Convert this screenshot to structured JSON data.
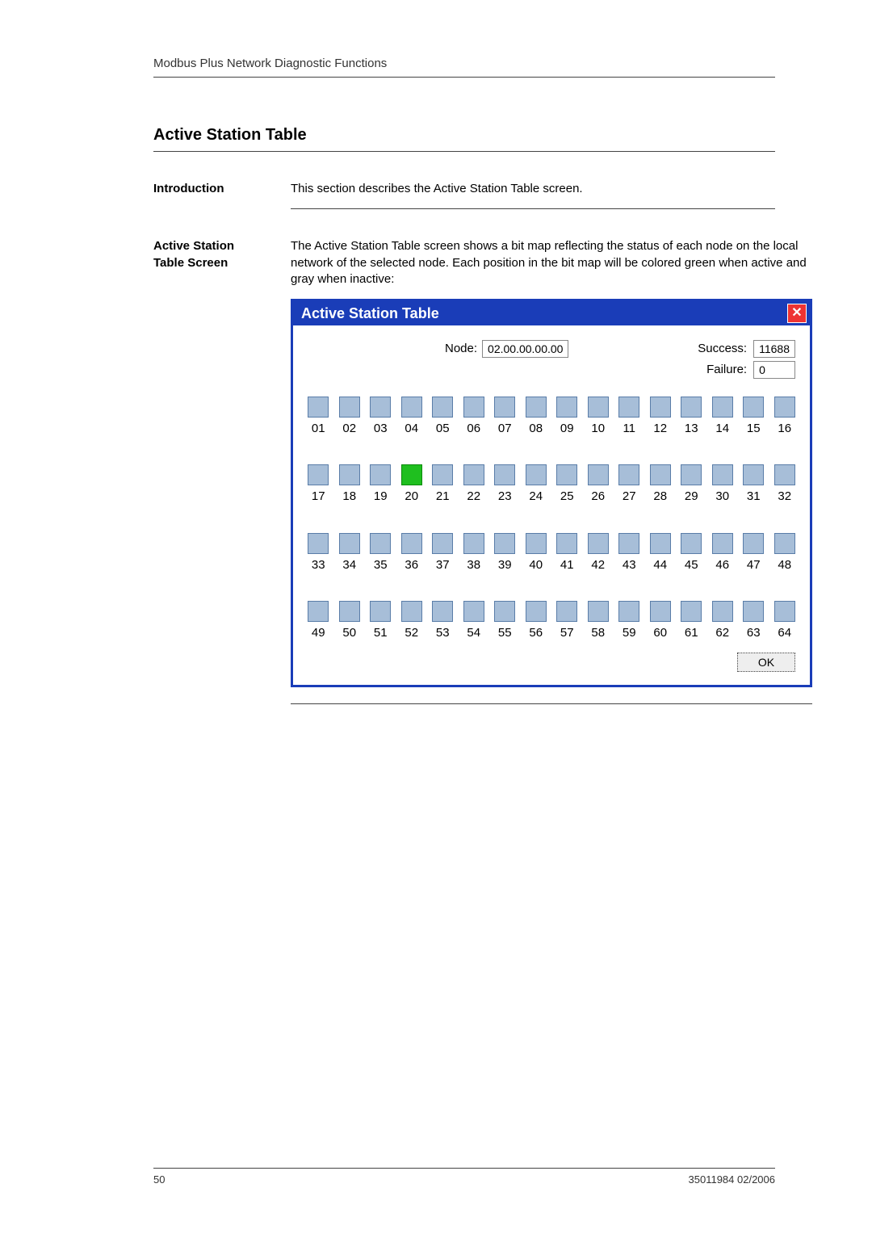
{
  "header": {
    "chapter": "Modbus Plus Network Diagnostic Functions"
  },
  "title": "Active Station Table",
  "intro": {
    "label": "Introduction",
    "text": "This section describes the Active Station Table screen."
  },
  "screen": {
    "label1": "Active Station",
    "label2": "Table Screen",
    "text": "The Active Station Table screen shows a bit map reflecting the status of each node on the local network of the selected node. Each position in the bit map will be colored green when active and gray when inactive:"
  },
  "dialog": {
    "title": "Active Station Table",
    "close": "✕",
    "node_label": "Node:",
    "node_value": "02.00.00.00.00",
    "success_label": "Success:",
    "success_value": "11688",
    "failure_label": "Failure:",
    "failure_value": "0",
    "ok": "OK",
    "active_nodes": [
      20
    ],
    "labels": [
      "01",
      "02",
      "03",
      "04",
      "05",
      "06",
      "07",
      "08",
      "09",
      "10",
      "11",
      "12",
      "13",
      "14",
      "15",
      "16",
      "17",
      "18",
      "19",
      "20",
      "21",
      "22",
      "23",
      "24",
      "25",
      "26",
      "27",
      "28",
      "29",
      "30",
      "31",
      "32",
      "33",
      "34",
      "35",
      "36",
      "37",
      "38",
      "39",
      "40",
      "41",
      "42",
      "43",
      "44",
      "45",
      "46",
      "47",
      "48",
      "49",
      "50",
      "51",
      "52",
      "53",
      "54",
      "55",
      "56",
      "57",
      "58",
      "59",
      "60",
      "61",
      "62",
      "63",
      "64"
    ]
  },
  "footer": {
    "page": "50",
    "docref": "35011984 02/2006"
  }
}
